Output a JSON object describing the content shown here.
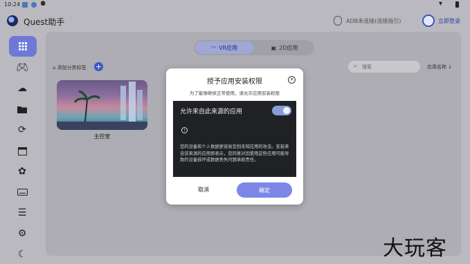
{
  "statusbar": {
    "time": "10:24",
    "icons": [
      "notification-icon",
      "bluetooth-icon",
      "tencent-icon",
      "wifi-icon",
      "battery-icon"
    ]
  },
  "header": {
    "app_title": "Quest助手",
    "adb_status": "ADB未连接(连接指引)",
    "login_label": "立即登录"
  },
  "sidebar": {
    "items": [
      {
        "name": "apps-grid",
        "icon": "grid-icon",
        "active": true
      },
      {
        "name": "games",
        "icon": "gamepad-icon"
      },
      {
        "name": "cloud-download",
        "icon": "cloud-download-icon"
      },
      {
        "name": "files",
        "icon": "folder-icon"
      },
      {
        "name": "refresh-settings",
        "icon": "refresh-icon"
      },
      {
        "name": "calendar",
        "icon": "calendar-icon"
      },
      {
        "name": "openai",
        "icon": "openai-icon"
      },
      {
        "name": "keyboard",
        "icon": "keyboard-icon"
      },
      {
        "name": "list",
        "icon": "list-icon"
      },
      {
        "name": "settings",
        "icon": "gear-icon"
      },
      {
        "name": "dark-mode",
        "icon": "moon-icon"
      }
    ]
  },
  "main": {
    "tabs": [
      {
        "label": "VR应用",
        "active": true
      },
      {
        "label": "2D应用",
        "active": false
      }
    ],
    "add_category_label": "添加分类标签",
    "search_placeholder": "搜索",
    "sort_label": "应用名称",
    "apps": [
      {
        "name": "主控室"
      }
    ]
  },
  "dialog": {
    "title": "授予应用安装权限",
    "subtitle": "为了能够继续正常使用，请允许应用安装权限",
    "toggle_label": "允许来自此来源的应用",
    "toggle_on": true,
    "warning": "您的设备和个人数据更容易受到未知应用的攻击。安装来自该来源的应用即表示，您同意对因使用这些应用可能导致的设备损坏或数据丢失问题承担责任。",
    "cancel_label": "取消",
    "confirm_label": "确定"
  },
  "watermark": {
    "text": "大玩客"
  },
  "colors": {
    "accent": "#7d87e8",
    "sidebar_active": "#6d78d8",
    "dark_panel": "#1f2124"
  }
}
